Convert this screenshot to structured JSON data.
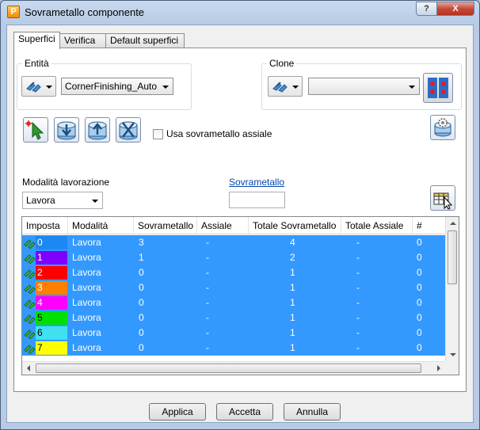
{
  "window": {
    "title": "Sovrametallo componente",
    "app_icon_letter": "P",
    "help_label": "?",
    "close_label": "X"
  },
  "tabs": [
    {
      "label": "Superfici",
      "active": true
    },
    {
      "label": "Verifica",
      "active": false
    },
    {
      "label": "Default superfici",
      "active": false
    }
  ],
  "entity": {
    "group_label": "Entità",
    "selected": "CornerFinishing_Auto"
  },
  "clone": {
    "group_label": "Clone",
    "selected": ""
  },
  "toolbar": {
    "icons": [
      "select-arrow-icon",
      "push-down-icon",
      "push-up-icon",
      "swap-icon"
    ],
    "axial_checkbox_label": "Usa sovrametallo assiale",
    "axial_checked": false
  },
  "machining": {
    "label": "Modalità lavorazione",
    "selected": "Lavora"
  },
  "thickness": {
    "link_label": "Sovrametallo",
    "value": ""
  },
  "grid": {
    "columns": [
      "Imposta",
      "Modalità",
      "Sovrametallo",
      "Assiale",
      "Totale Sovrametallo",
      "Totale Assiale",
      "#"
    ],
    "rows": [
      {
        "set": "0",
        "color": "#1d87f2",
        "mode": "Lavora",
        "thickness": "3",
        "axial": "-",
        "total": "4",
        "total_axial": "-",
        "count": "0"
      },
      {
        "set": "1",
        "color": "#8000ff",
        "mode": "Lavora",
        "thickness": "1",
        "axial": "-",
        "total": "2",
        "total_axial": "-",
        "count": "0"
      },
      {
        "set": "2",
        "color": "#ff0000",
        "mode": "Lavora",
        "thickness": "0",
        "axial": "-",
        "total": "1",
        "total_axial": "-",
        "count": "0"
      },
      {
        "set": "3",
        "color": "#ff8000",
        "mode": "Lavora",
        "thickness": "0",
        "axial": "-",
        "total": "1",
        "total_axial": "-",
        "count": "0"
      },
      {
        "set": "4",
        "color": "#ff00ff",
        "mode": "Lavora",
        "thickness": "0",
        "axial": "-",
        "total": "1",
        "total_axial": "-",
        "count": "0"
      },
      {
        "set": "5",
        "color": "#00e000",
        "mode": "Lavora",
        "thickness": "0",
        "axial": "-",
        "total": "1",
        "total_axial": "-",
        "count": "0"
      },
      {
        "set": "6",
        "color": "#40e0f0",
        "mode": "Lavora",
        "thickness": "0",
        "axial": "-",
        "total": "1",
        "total_axial": "-",
        "count": "0"
      },
      {
        "set": "7",
        "color": "#ffff00",
        "mode": "Lavora",
        "thickness": "0",
        "axial": "-",
        "total": "1",
        "total_axial": "-",
        "count": "0"
      }
    ]
  },
  "buttons": {
    "apply": "Applica",
    "accept": "Accetta",
    "cancel": "Annulla"
  }
}
